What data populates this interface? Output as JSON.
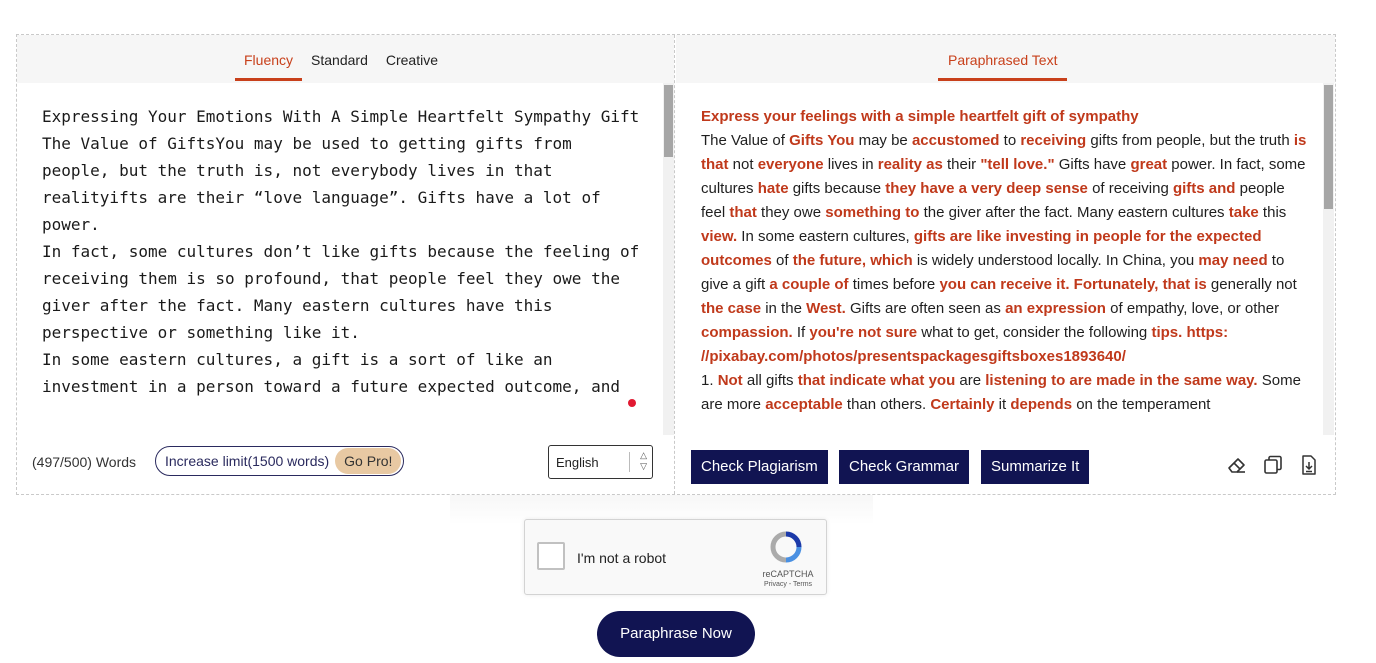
{
  "left": {
    "tabs": [
      "Fluency",
      "Standard",
      "Creative"
    ],
    "active_tab": "Fluency",
    "input_text": "Expressing Your Emotions With A Simple Heartfelt Sympathy Gift\nThe Value of GiftsYou may be used to getting gifts from people, but the truth is, not everybody lives in that realityifts are their “love language”. Gifts have a lot of power.\nIn fact, some cultures don’t like gifts because the feeling of receiving them is so profound, that people feel they owe the giver after the fact. Many eastern cultures have this perspective or something like it.\nIn some eastern cultures, a gift is a sort of like an investment in a person toward a future expected outcome, and",
    "word_count": "(497/500) Words",
    "limit_label": "Increase limit(1500 words)",
    "gopro_label": "Go Pro!",
    "language": "English"
  },
  "right": {
    "tab": "Paraphrased Text",
    "output_segments": [
      [
        "Express your feelings with a simple heartfelt gift of sympathy",
        1
      ],
      [
        "\n The Value of ",
        0
      ],
      [
        "Gifts You",
        1
      ],
      [
        " may be ",
        0
      ],
      [
        "accustomed",
        1
      ],
      [
        " to ",
        0
      ],
      [
        "receiving",
        1
      ],
      [
        " gifts from people, but the truth ",
        0
      ],
      [
        "is that",
        1
      ],
      [
        " not ",
        0
      ],
      [
        "everyone",
        1
      ],
      [
        " lives in ",
        0
      ],
      [
        "reality as",
        1
      ],
      [
        " their ",
        0
      ],
      [
        "\"tell love.\"",
        1
      ],
      [
        " Gifts have ",
        0
      ],
      [
        "great",
        1
      ],
      [
        " power.  In fact, some cultures ",
        0
      ],
      [
        "hate",
        1
      ],
      [
        " gifts because ",
        0
      ],
      [
        "they have a very deep sense",
        1
      ],
      [
        " of receiving ",
        0
      ],
      [
        "gifts and",
        1
      ],
      [
        " people feel ",
        0
      ],
      [
        "that",
        1
      ],
      [
        " they owe ",
        0
      ],
      [
        "something to",
        1
      ],
      [
        " the giver after the fact. Many eastern cultures ",
        0
      ],
      [
        "take",
        1
      ],
      [
        " this ",
        0
      ],
      [
        "view.",
        1
      ],
      [
        " In some eastern cultures, ",
        0
      ],
      [
        "gifts are like investing in people for the expected outcomes",
        1
      ],
      [
        " of ",
        0
      ],
      [
        "the future, which",
        1
      ],
      [
        " is widely understood locally. In China, you ",
        0
      ],
      [
        "may need",
        1
      ],
      [
        " to give  a gift ",
        0
      ],
      [
        "a couple of",
        1
      ],
      [
        " times before ",
        0
      ],
      [
        "you can receive it. Fortunately, that is",
        1
      ],
      [
        " generally not ",
        0
      ],
      [
        "the case",
        1
      ],
      [
        " in the ",
        0
      ],
      [
        "West.",
        1
      ],
      [
        " Gifts are often seen as ",
        0
      ],
      [
        "an expression",
        1
      ],
      [
        " of empathy, love, or other ",
        0
      ],
      [
        "compassion.",
        1
      ],
      [
        " If ",
        0
      ],
      [
        "you're not sure",
        1
      ],
      [
        " what to get, consider the following ",
        0
      ],
      [
        "tips. https: //pixabay.com/photos/presentspackagesgiftsboxes1893640/",
        1
      ],
      [
        "\n 1. ",
        0
      ],
      [
        "Not",
        1
      ],
      [
        " all gifts ",
        0
      ],
      [
        "that indicate what you",
        1
      ],
      [
        " are ",
        0
      ],
      [
        "listening to are made in the same way.",
        1
      ],
      [
        " Some are  more ",
        0
      ],
      [
        "acceptable",
        1
      ],
      [
        " than others. ",
        0
      ],
      [
        "Certainly",
        1
      ],
      [
        " it ",
        0
      ],
      [
        "depends",
        1
      ],
      [
        " on the temperament",
        0
      ]
    ],
    "buttons": {
      "plagiarism": "Check Plagiarism",
      "grammar": "Check Grammar",
      "summarize": "Summarize It"
    }
  },
  "captcha": {
    "label": "I'm not a robot",
    "brand": "reCAPTCHA",
    "links": "Privacy - Terms"
  },
  "paraphrase_button": "Paraphrase Now",
  "colors": {
    "accent": "#c8401b",
    "navy": "#111452",
    "gopro": "#e8c9a3"
  }
}
